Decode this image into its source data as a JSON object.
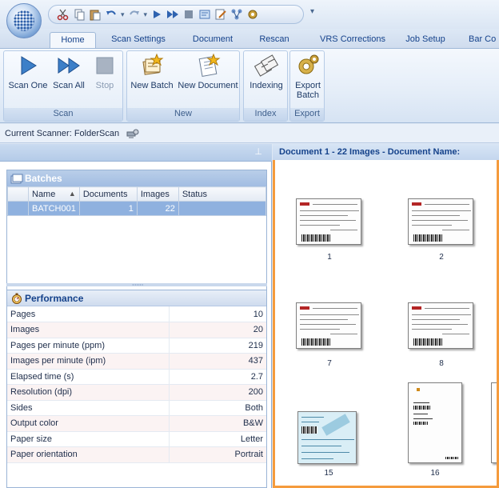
{
  "quick_access": {
    "icons": [
      "cut-icon",
      "copy-icon",
      "paste-icon",
      "undo-icon",
      "redo-icon",
      "play-icon",
      "fast-forward-icon",
      "stop-icon",
      "settings-icon",
      "edit-icon",
      "network-icon",
      "gear-icon"
    ],
    "more_label": "▾"
  },
  "tabs": [
    {
      "label": "Home",
      "active": true
    },
    {
      "label": "Scan Settings",
      "active": false
    },
    {
      "label": "Document",
      "active": false
    },
    {
      "label": "Rescan",
      "active": false
    },
    {
      "label": "VRS Corrections",
      "active": false
    },
    {
      "label": "Job Setup",
      "active": false
    },
    {
      "label": "Bar Co",
      "active": false
    }
  ],
  "ribbon": {
    "scan_group": {
      "label": "Scan",
      "buttons": [
        {
          "label": "Scan One",
          "icon": "play-icon",
          "enabled": true
        },
        {
          "label": "Scan All",
          "icon": "fast-forward-icon",
          "enabled": true
        },
        {
          "label": "Stop",
          "icon": "stop-icon",
          "enabled": false
        }
      ]
    },
    "new_group": {
      "label": "New",
      "buttons": [
        {
          "label": "New Batch",
          "icon": "new-batch-icon"
        },
        {
          "label": "New Document",
          "icon": "new-document-icon"
        }
      ]
    },
    "index_group": {
      "label": "Index",
      "buttons": [
        {
          "label": "Indexing",
          "icon": "indexing-icon"
        }
      ]
    },
    "export_group": {
      "label": "Export",
      "buttons": [
        {
          "label_line1": "Export",
          "label_line2": "Batch",
          "icon": "export-batch-icon"
        }
      ]
    }
  },
  "scanner_bar": {
    "label": "Current Scanner: FolderScan"
  },
  "left_panel": {
    "pin_glyph": "⊥",
    "batches": {
      "title": "Batches",
      "columns": [
        "Name",
        "Documents",
        "Images",
        "Status"
      ],
      "sort_glyph": "▲",
      "rows": [
        {
          "name": "BATCH001",
          "documents": "1",
          "images": "22",
          "status": "",
          "selected": true
        }
      ]
    },
    "performance": {
      "title": "Performance",
      "rows": [
        {
          "key": "Pages",
          "value": "10"
        },
        {
          "key": "Images",
          "value": "20"
        },
        {
          "key": "Pages per minute (ppm)",
          "value": "219"
        },
        {
          "key": "Images per minute (ipm)",
          "value": "437"
        },
        {
          "key": "Elapsed time (s)",
          "value": "2.7"
        },
        {
          "key": "Resolution (dpi)",
          "value": "200"
        },
        {
          "key": "Sides",
          "value": "Both"
        },
        {
          "key": "Output color",
          "value": "B&W"
        },
        {
          "key": "Paper size",
          "value": "Letter"
        },
        {
          "key": "Paper orientation",
          "value": "Portrait"
        }
      ]
    }
  },
  "viewer": {
    "title": "Document 1 - 22 Images - Document Name:",
    "thumbnails": [
      {
        "caption": "1",
        "kind": "landscape-form"
      },
      {
        "caption": "2",
        "kind": "landscape-form"
      },
      {
        "caption": "7",
        "kind": "landscape-form"
      },
      {
        "caption": "8",
        "kind": "landscape-form"
      },
      {
        "caption": "15",
        "kind": "blue-form"
      },
      {
        "caption": "16",
        "kind": "portrait-letter"
      }
    ]
  },
  "colors": {
    "accent": "#f59b3c",
    "selection": "#8fb1df",
    "ribbon_text": "#15428b"
  }
}
